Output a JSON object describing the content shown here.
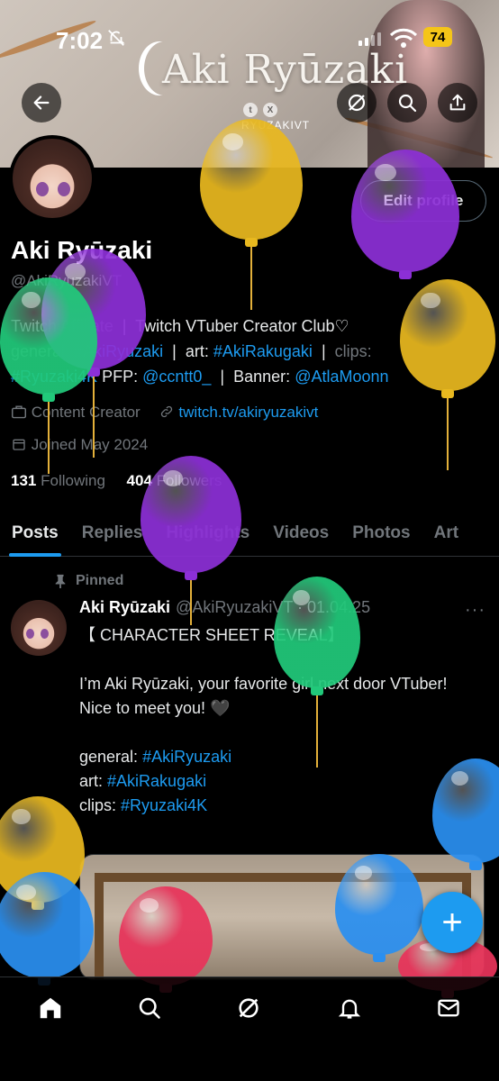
{
  "status_bar": {
    "time": "7:02",
    "battery": "74"
  },
  "banner": {
    "title": "Aki Ryūzaki",
    "handle": "RYUZAKIVT"
  },
  "profile": {
    "edit_label": "Edit profile",
    "name": "Aki Ryūzaki",
    "handle": "@AkiRyuzakiVT",
    "bio": {
      "line1_a": "Twitch Affiliate",
      "sep": "|",
      "line1_b": "Twitch VTuber Creator Club",
      "heart": "♡",
      "general_label": "general:",
      "general_tag": "#AkiRyuzaki",
      "art_label": "art:",
      "art_tag": "#AkiRakugaki",
      "clips_label": "clips:",
      "clips_tag": "#Ryuzaki4K",
      "pfp_label": "PFP:",
      "pfp_user": "@ccntt0_",
      "banner_label": "Banner:",
      "banner_user": "@AtlaMoonn"
    },
    "category": "Content Creator",
    "link": "twitch.tv/akiryuzakivt",
    "joined": "Joined May 2024",
    "following_count": "131",
    "following_label": "Following",
    "followers_count": "404",
    "followers_label": "Followers"
  },
  "tabs": [
    "Posts",
    "Replies",
    "Highlights",
    "Videos",
    "Photos",
    "Art"
  ],
  "tweet": {
    "pinned_label": "Pinned",
    "author": "Aki Ryūzaki",
    "handle_date": "@AkiRyuzakiVT · 01.04.25",
    "more": "···",
    "title": "【 CHARACTER SHEET REVEAL】",
    "line1": "I’m Aki Ryūzaki, your favorite girl next door VTuber!",
    "line2": "Nice to meet you! 🖤",
    "general_label": "general:",
    "general_tag": "#AkiRyuzaki",
    "art_label": "art:",
    "art_tag": "#AkiRakugaki",
    "clips_label": "clips:",
    "clips_tag": "#Ryuzaki4K"
  },
  "fab": {
    "label": "+"
  },
  "colors": {
    "accent": "#1d9bf0",
    "muted": "#71767b",
    "balloon_yellow": "#e8b81f",
    "balloon_purple": "#8c2fd6",
    "balloon_green": "#21c97a",
    "balloon_blue": "#2a8ff0",
    "balloon_red": "#e8335a"
  },
  "icons": {
    "back": "arrow-left-icon",
    "grok": "slash-circle-icon",
    "search": "search-icon",
    "share": "share-icon",
    "home": "home-icon",
    "notifications": "bell-icon",
    "messages": "mail-icon"
  }
}
